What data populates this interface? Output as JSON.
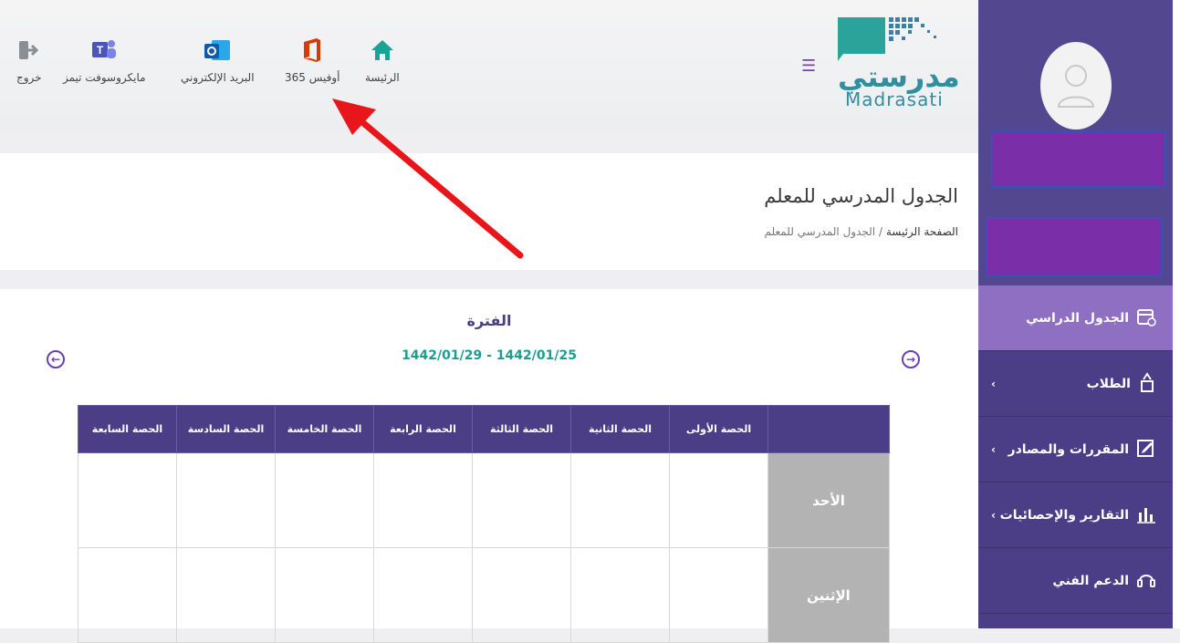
{
  "header": {
    "nav": [
      {
        "label": "الرئيسة",
        "icon": "home-icon"
      },
      {
        "label": "أوفيس 365",
        "icon": "office-365-icon"
      },
      {
        "label": "البريد الإلكتروني",
        "icon": "outlook-mail-icon"
      },
      {
        "label": "مايكروسوفت تيمز",
        "icon": "teams-icon"
      },
      {
        "label": "خروج",
        "icon": "logout-icon"
      }
    ],
    "logo_ar": "مدرستي",
    "logo_en": "Madrasati"
  },
  "page": {
    "title": "الجدول المدرسي للمعلم",
    "breadcrumb_home": "الصفحة الرئيسة",
    "breadcrumb_sep": "/",
    "breadcrumb_current": "الجدول المدرسي للمعلم"
  },
  "schedule": {
    "period_label": "الفترة",
    "period_dates": "1442/01/29 - 1442/01/25",
    "columns": [
      "الحصة الأولى",
      "الحصة الثانية",
      "الحصة الثالثة",
      "الحصة الرابعة",
      "الحصة الخامسة",
      "الحصة السادسة",
      "الحصة السابعة"
    ],
    "days": [
      "الأحد",
      "الإثنين"
    ]
  },
  "sidebar": {
    "items": [
      {
        "label": "الجدول الدراسي",
        "icon": "calendar-icon",
        "active": true,
        "chevron": false
      },
      {
        "label": "الطلاب",
        "icon": "student-icon",
        "active": false,
        "chevron": true
      },
      {
        "label": "المقررات والمصادر",
        "icon": "edit-note-icon",
        "active": false,
        "chevron": true
      },
      {
        "label": "التقارير والإحصائيات",
        "icon": "bar-chart-icon",
        "active": false,
        "chevron": true
      },
      {
        "label": "الدعم الفني",
        "icon": "headset-icon",
        "active": false,
        "chevron": false
      }
    ]
  },
  "colors": {
    "primary": "#4b3d86",
    "accent_teal": "#1f9c8d",
    "highlight_purple": "#7a2ea8",
    "arrow_red": "#e8161b",
    "office_orange": "#d83b01"
  }
}
